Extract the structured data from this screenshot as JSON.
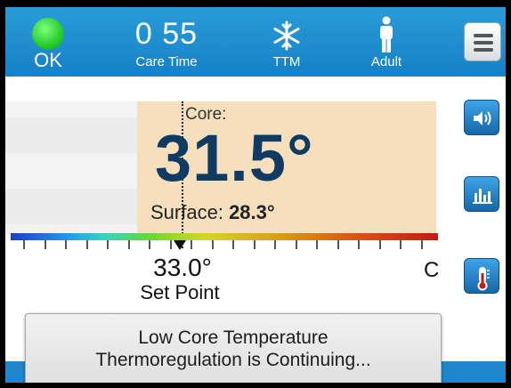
{
  "header": {
    "status_label": "OK",
    "status_color": "#19c11f",
    "care_time_value": "0 55",
    "care_time_label": "Care Time",
    "mode_icon": "snowflake-icon",
    "mode_label": "TTM",
    "patient_icon": "adult-person-icon",
    "patient_label": "Adult",
    "menu_icon": "hamburger-menu-icon"
  },
  "side_buttons": [
    {
      "name": "volume",
      "icon": "speaker-icon"
    },
    {
      "name": "trend",
      "icon": "bar-chart-icon"
    },
    {
      "name": "temperature",
      "icon": "thermometer-icon"
    }
  ],
  "temperature": {
    "core_label": "Core:",
    "core_value": "31.5°",
    "surface_label": "Surface:",
    "surface_value": "28.3°"
  },
  "setpoint": {
    "value": "33.0°",
    "label": "Set Point",
    "unit": "C"
  },
  "alert": {
    "line1": "Low Core Temperature",
    "line2": "Thermoregulation is Continuing..."
  },
  "colors": {
    "header_blue": "#1f8ccc",
    "core_panel": "#f6dfbc",
    "core_value": "#0f3b63"
  }
}
